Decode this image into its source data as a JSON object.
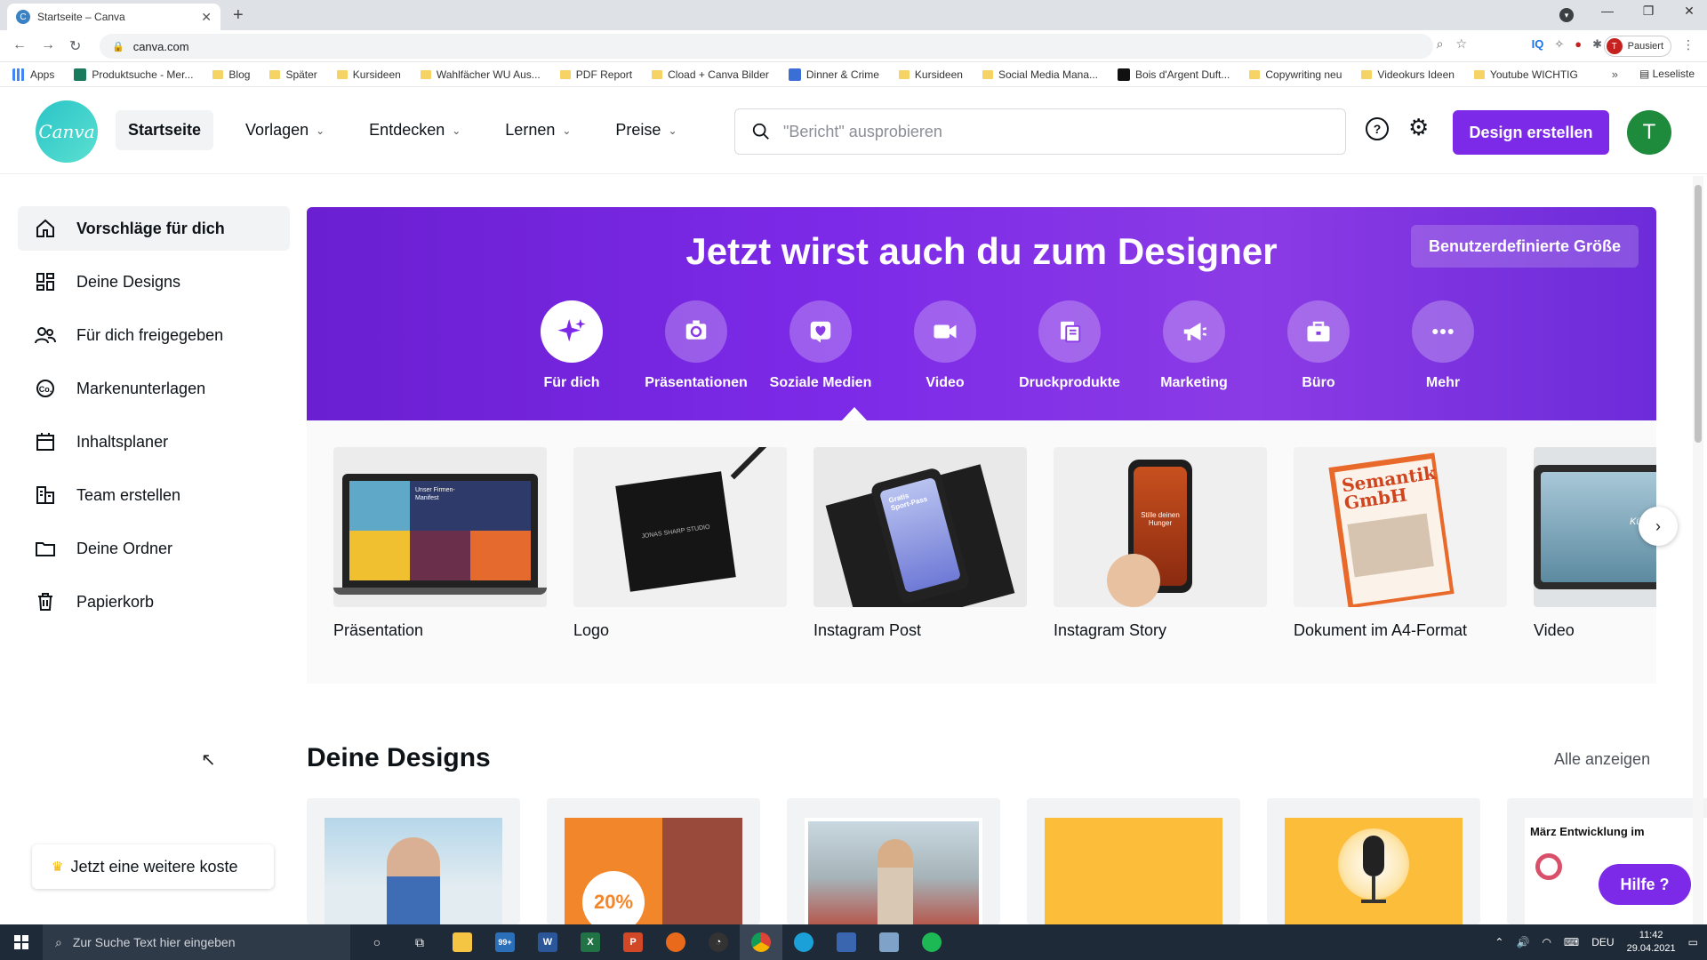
{
  "browser": {
    "tab_title": "Startseite – Canva",
    "url": "canva.com",
    "profile_label": "Pausiert",
    "profile_initial": "T",
    "bookmarks": [
      "Apps",
      "Produktsuche - Mer...",
      "Blog",
      "Später",
      "Kursideen",
      "Wahlfächer WU Aus...",
      "PDF Report",
      "Cload + Canva Bilder",
      "Dinner & Crime",
      "Kursideen",
      "Social Media Mana...",
      "Bois d'Argent Duft...",
      "Copywriting neu",
      "Videokurs Ideen",
      "Youtube WICHTIG"
    ],
    "reading_list": "Leseliste"
  },
  "header": {
    "logo_text": "Canva",
    "nav": [
      "Startseite",
      "Vorlagen",
      "Entdecken",
      "Lernen",
      "Preise"
    ],
    "search_placeholder": "\"Bericht\" ausprobieren",
    "create_button": "Design erstellen",
    "avatar_initial": "T"
  },
  "sidebar": {
    "items": [
      {
        "label": "Vorschläge für dich",
        "icon": "home-icon"
      },
      {
        "label": "Deine Designs",
        "icon": "grid-icon"
      },
      {
        "label": "Für dich freigegeben",
        "icon": "users-icon"
      },
      {
        "label": "Markenunterlagen",
        "icon": "brand-kit-icon"
      },
      {
        "label": "Inhaltsplaner",
        "icon": "calendar-icon"
      },
      {
        "label": "Team erstellen",
        "icon": "team-icon"
      },
      {
        "label": "Deine Ordner",
        "icon": "folder-icon"
      },
      {
        "label": "Papierkorb",
        "icon": "trash-icon"
      }
    ],
    "upgrade_label": "Jetzt eine weitere koste"
  },
  "hero": {
    "title": "Jetzt wirst auch du zum Designer",
    "custom_size_button": "Benutzerdefinierte Größe",
    "categories": [
      {
        "label": "Für dich",
        "icon": "sparkle-icon"
      },
      {
        "label": "Präsentationen",
        "icon": "presentation-icon"
      },
      {
        "label": "Soziale Medien",
        "icon": "heart-icon"
      },
      {
        "label": "Video",
        "icon": "video-camera-icon"
      },
      {
        "label": "Druckprodukte",
        "icon": "print-icon"
      },
      {
        "label": "Marketing",
        "icon": "megaphone-icon"
      },
      {
        "label": "Büro",
        "icon": "briefcase-icon"
      },
      {
        "label": "Mehr",
        "icon": "more-dots-icon"
      }
    ]
  },
  "templates": [
    {
      "label": "Präsentation",
      "thumb_text": "Unser Firmen-Manifest"
    },
    {
      "label": "Logo",
      "thumb_text": "JONAS SHARP STUDIO"
    },
    {
      "label": "Instagram Post",
      "thumb_text": "Gratis Sport-Pass"
    },
    {
      "label": "Instagram Story",
      "thumb_text": "Stille deinen Hunger"
    },
    {
      "label": "Dokument im A4-Format",
      "thumb_text": "Semantik GmbH"
    },
    {
      "label": "Video",
      "thumb_text": "Kümmere mentale"
    }
  ],
  "designs": {
    "title": "Deine Designs",
    "see_all": "Alle anzeigen",
    "card_texts": [
      "",
      "20%",
      "",
      "",
      "",
      "März Entwicklung im"
    ]
  },
  "help_button": "Hilfe ?",
  "taskbar": {
    "search_placeholder": "Zur Suche Text hier eingeben",
    "mail_badge": "99+",
    "language": "DEU",
    "time": "11:42",
    "date": "29.04.2021"
  },
  "colors": {
    "brand_purple": "#7d2ae8",
    "canva_teal": "#2ac4c7",
    "avatar_green": "#1e8a3c"
  }
}
